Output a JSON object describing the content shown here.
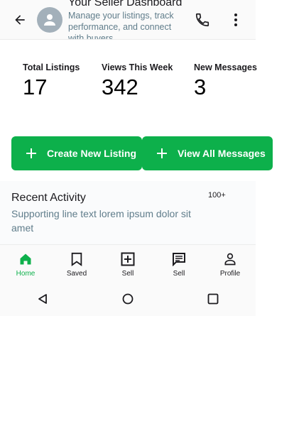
{
  "topbar": {
    "title": "Your Seller Dashboard",
    "subtitle": "Manage your listings, track performance, and connect with buyers",
    "icons": {
      "back": "arrow-back-icon",
      "avatar": "person-icon",
      "call": "phone-icon",
      "more": "more-vert-icon"
    }
  },
  "stats": [
    {
      "label": "Total Listings",
      "value": "17"
    },
    {
      "label": "Views This Week",
      "value": "342"
    },
    {
      "label": "New Messages",
      "value": "3"
    }
  ],
  "actions": {
    "create_label": "Create New Listing",
    "messages_label": "View All Messages",
    "icon": "plus-icon"
  },
  "activity": {
    "title": "Recent Activity",
    "subtitle": "Supporting line text lorem ipsum dolor sit amet",
    "meta": "100+"
  },
  "bottom_nav": {
    "items": [
      {
        "label": "Home",
        "icon": "home-icon",
        "active": true
      },
      {
        "label": "Saved",
        "icon": "bookmark-icon"
      },
      {
        "label": "Sell",
        "icon": "add-box-icon"
      },
      {
        "label": "Sell",
        "icon": "message-icon"
      },
      {
        "label": "Profile",
        "icon": "person-outline-icon"
      }
    ]
  },
  "system_nav": {
    "icons": [
      "back-triangle-icon",
      "home-circle-icon",
      "recents-square-icon"
    ]
  },
  "colors": {
    "accent": "#0db04b",
    "secondary_text": "#607d8b",
    "avatar_bg": "#a3b0ba"
  }
}
